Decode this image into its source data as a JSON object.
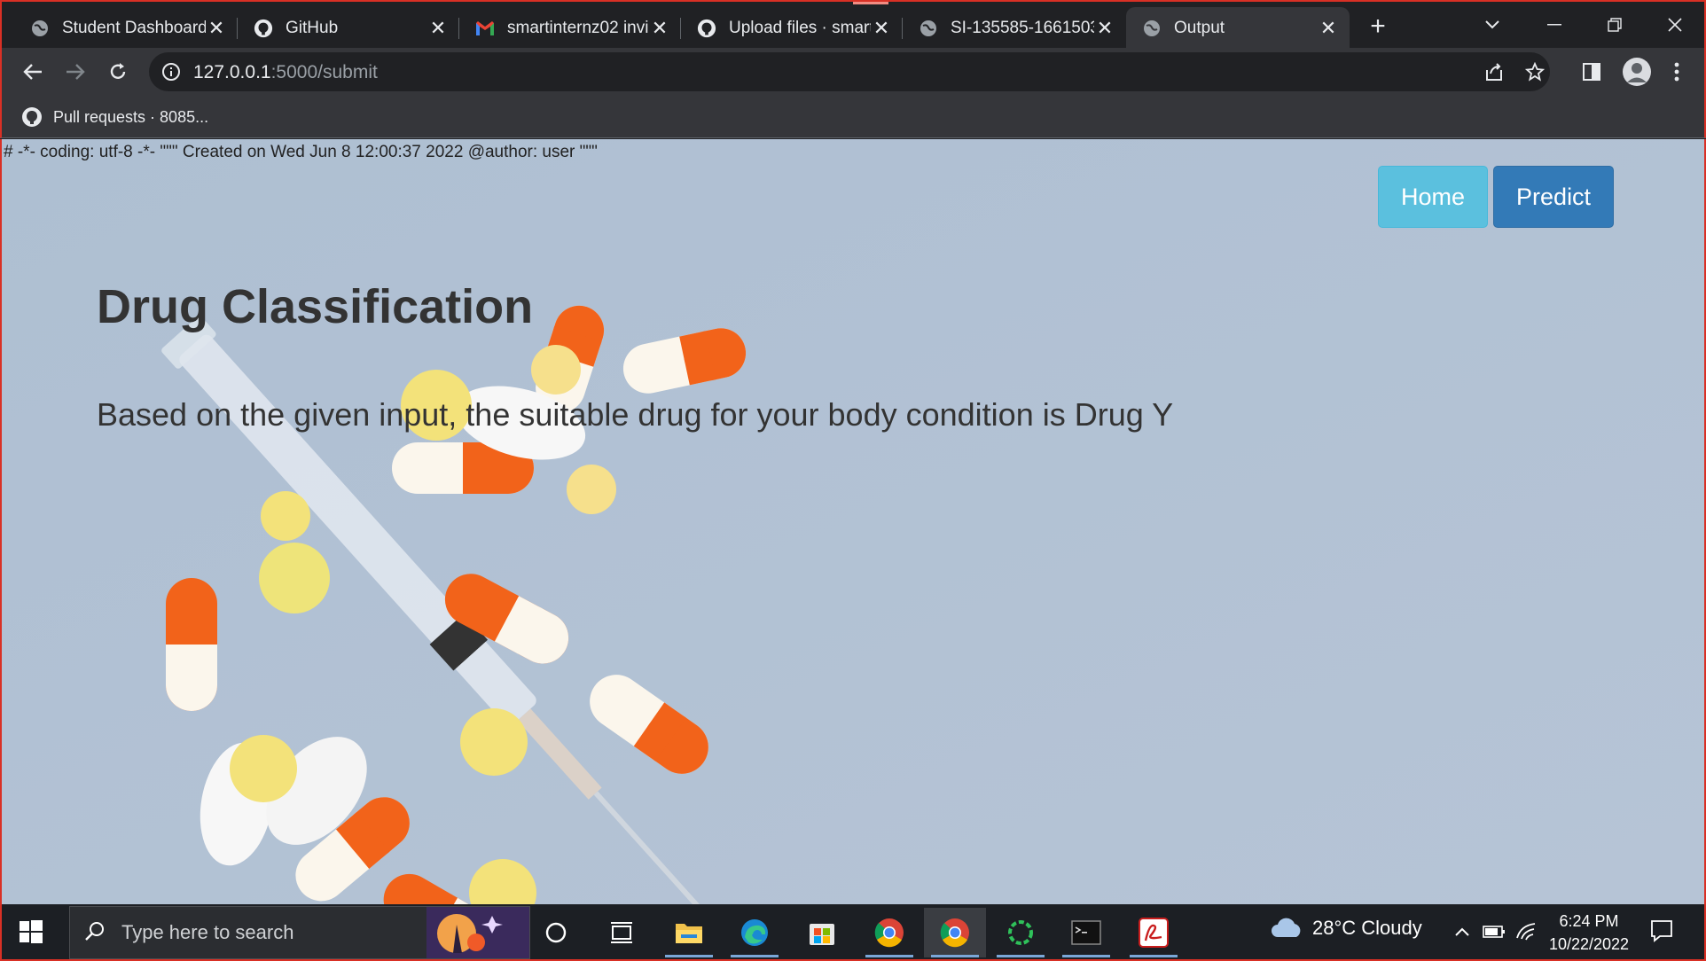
{
  "browser": {
    "tabs": [
      {
        "title": "Student Dashboard",
        "icon": "globe-icon",
        "active": false
      },
      {
        "title": "GitHub",
        "icon": "github-icon",
        "active": false
      },
      {
        "title": "smartinternz02 invi",
        "icon": "gmail-icon",
        "active": false
      },
      {
        "title": "Upload files · smart",
        "icon": "github-icon",
        "active": false
      },
      {
        "title": "SI-135585-1661503",
        "icon": "globe-icon",
        "active": false
      },
      {
        "title": "Output",
        "icon": "globe-icon",
        "active": true
      }
    ],
    "url_host": "127.0.0.1",
    "url_rest": ":5000/submit",
    "bookmark": {
      "label": "Pull requests · 8085...",
      "icon": "github-icon"
    }
  },
  "page": {
    "code_header": "# -*- coding: utf-8 -*- \"\"\" Created on Wed Jun 8 12:00:37 2022 @author: user \"\"\"",
    "nav": {
      "home_label": "Home",
      "predict_label": "Predict"
    },
    "title": "Drug Classification",
    "prediction_text": "Based on the given input, the suitable drug for your body condition is Drug Y",
    "colors": {
      "home_button": "#5bc0de",
      "predict_button": "#337ab7",
      "background": "#b3c1d3"
    }
  },
  "taskbar": {
    "search_placeholder": "Type here to search",
    "weather": "28°C  Cloudy",
    "time": "6:24 PM",
    "date": "10/22/2022",
    "apps": [
      "task-view-icon",
      "file-explorer-icon",
      "edge-icon",
      "store-icon",
      "chrome-icon",
      "chrome-icon",
      "loader-app-icon",
      "terminal-icon",
      "pdf-app-icon"
    ]
  }
}
